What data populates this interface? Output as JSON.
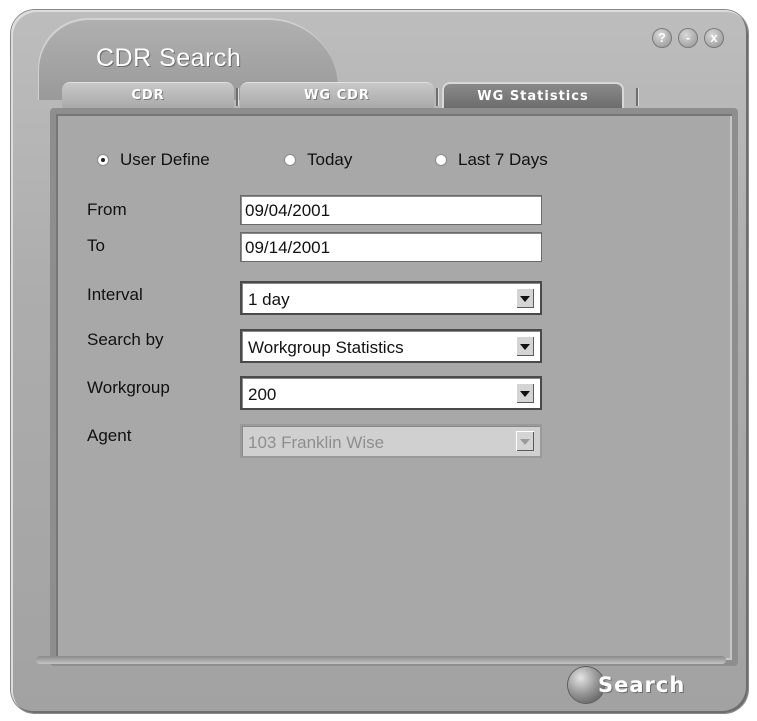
{
  "window": {
    "title": "CDR Search",
    "controls": {
      "help": "?",
      "minimize": "-",
      "close": "x"
    }
  },
  "tabs": [
    {
      "label": "CDR",
      "active": false
    },
    {
      "label": "WG CDR",
      "active": false
    },
    {
      "label": "WG Statistics",
      "active": true
    }
  ],
  "date_range": {
    "options": [
      {
        "label": "User Define",
        "checked": true
      },
      {
        "label": "Today",
        "checked": false
      },
      {
        "label": "Last 7 Days",
        "checked": false
      }
    ]
  },
  "form": {
    "from": {
      "label": "From",
      "value": "09/04/2001"
    },
    "to": {
      "label": "To",
      "value": "09/14/2001"
    },
    "interval": {
      "label": "Interval",
      "value": "1 day"
    },
    "search_by": {
      "label": "Search by",
      "value": "Workgroup Statistics"
    },
    "workgroup": {
      "label": "Workgroup",
      "value": "200"
    },
    "agent": {
      "label": "Agent",
      "value": "103  Franklin Wise",
      "disabled": true
    }
  },
  "actions": {
    "search_label": "Search"
  },
  "colors": {
    "window_bg": "#adadad",
    "panel_bg": "#a8a8a8",
    "active_tab": "#7a7a7a"
  }
}
